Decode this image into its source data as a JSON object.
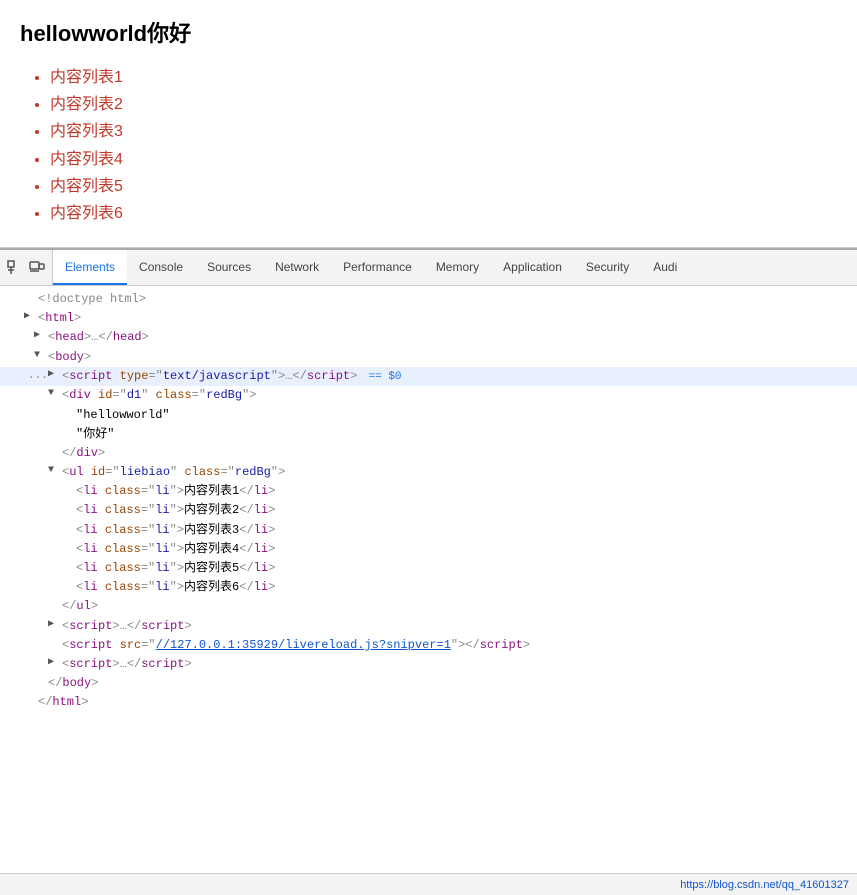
{
  "page": {
    "title": "hellowworld你好",
    "list_items": [
      "内容列表1",
      "内容列表2",
      "内容列表3",
      "内容列表4",
      "内容列表5",
      "内容列表6"
    ]
  },
  "devtools": {
    "tabs": [
      {
        "id": "elements",
        "label": "Elements",
        "active": true
      },
      {
        "id": "console",
        "label": "Console",
        "active": false
      },
      {
        "id": "sources",
        "label": "Sources",
        "active": false
      },
      {
        "id": "network",
        "label": "Network",
        "active": false
      },
      {
        "id": "performance",
        "label": "Performance",
        "active": false
      },
      {
        "id": "memory",
        "label": "Memory",
        "active": false
      },
      {
        "id": "application",
        "label": "Application",
        "active": false
      },
      {
        "id": "security",
        "label": "Security",
        "active": false
      },
      {
        "id": "audits",
        "label": "Audi",
        "active": false
      }
    ],
    "statusbar": {
      "url": "https://blog.csdn.net/qq_41601327"
    }
  }
}
